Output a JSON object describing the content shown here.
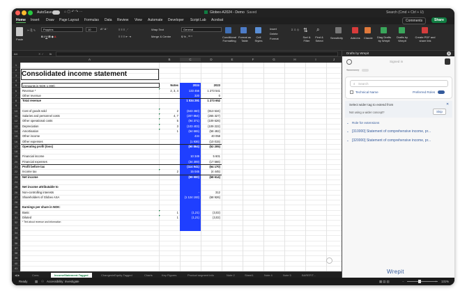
{
  "window": {
    "app_label": "AutoSave",
    "file_title": "Globex-A2024 - Demo",
    "saved": "Saved",
    "search_placeholder": "Search (Cmd + Ctrl + U)"
  },
  "ribbon_tabs": [
    "Home",
    "Insert",
    "Draw",
    "Page Layout",
    "Formulas",
    "Data",
    "Review",
    "View",
    "Automate",
    "Developer",
    "Script Lab",
    "Acrobat"
  ],
  "ribbon": {
    "comments_label": "Comments",
    "share_label": "Share",
    "paste": "Paste",
    "font_name": "Poppins",
    "font_size": "10",
    "wrap_text": "Wrap Text",
    "merge_center": "Merge & Centre",
    "number_format": "General",
    "conditional_formatting": "Conditional Formatting",
    "format_as_table": "Format as Table",
    "cell_styles": "Cell Styles",
    "insert": "Insert",
    "delete": "Delete",
    "format": "Format",
    "sort_filter": "Sort & Filter",
    "find_select": "Find & Select",
    "sensitivity": "Sensitivity",
    "add_ins": "Add-ins",
    "claude": "Claude",
    "diag_drafts": "Diag Drafts by Wrepit",
    "drafts_by_wrepit": "Drafts by Wrepit",
    "create_pdf": "Create PDF and share link"
  },
  "formula_bar": {
    "cell_ref": "A4",
    "fx": "fx"
  },
  "columns": [
    "A",
    "B",
    "C",
    "D",
    "E",
    "F",
    "G",
    "H",
    "I",
    "J"
  ],
  "rows": [
    "1",
    "2",
    "3",
    "4",
    "5",
    "6",
    "7",
    "8",
    "9",
    "10",
    "11",
    "12",
    "13",
    "14",
    "15",
    "16",
    "17",
    "18",
    "19",
    "20",
    "21",
    "22",
    "23",
    "24",
    "25",
    "26",
    "27",
    "28",
    "29",
    "30",
    "31",
    "32",
    "33",
    "34",
    "35",
    "36",
    "37",
    "38",
    "39",
    "40",
    "41"
  ],
  "sheet": {
    "title": "Consolidated income statement",
    "unit_label": "(Amounts in NOK 1 000)",
    "notes_header": "Notes",
    "year1": "2024",
    "year2": "2023",
    "lines": [
      {
        "row": 6,
        "label": "Revenue *",
        "notes": "2, 3, 4",
        "v1": "133 456",
        "v2": "1 273 541"
      },
      {
        "row": 7,
        "label": "Other revenue",
        "notes": "",
        "v1": "320",
        "v2": "0"
      },
      {
        "row": 8,
        "label": "Total revenue",
        "notes": "",
        "v1": "1 034 291",
        "v2": "1 273 652",
        "bold": true
      },
      {
        "row": 10,
        "label": "Cost of goods sold",
        "notes": "2",
        "v1": "(643 460)",
        "v2": "(813 534)"
      },
      {
        "row": 11,
        "label": "Salaries and personnel costs",
        "notes": "4, 7",
        "v1": "(207 864)",
        "v2": "(265 327)"
      },
      {
        "row": 12,
        "label": "Other operational costs",
        "notes": "5",
        "v1": "(94 371)",
        "v2": "(109 626)"
      },
      {
        "row": 13,
        "label": "Depreciation",
        "notes": "3",
        "v1": "(103 403)",
        "v2": "(109 222)"
      },
      {
        "row": 14,
        "label": "Amortisation",
        "notes": "1",
        "v1": "(64 665)",
        "v2": "(58 492)"
      },
      {
        "row": 15,
        "label": "Other income",
        "notes": "",
        "v1": "434",
        "v2": "40 058"
      },
      {
        "row": 16,
        "label": "Other expenses",
        "notes": "",
        "v1": "(1 936)",
        "v2": "(10 015)"
      },
      {
        "row": 17,
        "label": "Operating profit (loss)",
        "notes": "",
        "v1": "(90 864)",
        "v2": "(52 205)",
        "bold": true
      },
      {
        "row": 19,
        "label": "Financial income",
        "notes": "",
        "v1": "10 349",
        "v2": "5 601"
      },
      {
        "row": 20,
        "label": "Financial expenses",
        "notes": "",
        "v1": "(34 309)",
        "v2": "(17 566)"
      },
      {
        "row": 21,
        "label": "Profit before tax",
        "notes": "",
        "v1": "(114 941)",
        "v2": "(64 170)",
        "bold": true
      },
      {
        "row": 22,
        "label": "Income tax",
        "notes": "2",
        "v1": "15 045",
        "v2": "(4 445)"
      },
      {
        "row": 23,
        "label": "Net income",
        "notes": "",
        "v1": "(99 900)",
        "v2": "(68 614)",
        "bold": true
      },
      {
        "row": 25,
        "label": "Net income attributable to",
        "notes": "",
        "v1": "",
        "v2": "",
        "bold": true
      },
      {
        "row": 26,
        "label": "Non-controlling interests",
        "notes": "",
        "v1": "-",
        "v2": "312"
      },
      {
        "row": 27,
        "label": "Shareholders of Globex ASA",
        "notes": "",
        "v1": "(1 124 193)",
        "v2": "(68 926)"
      },
      {
        "row": 29,
        "label": "Earnings per share in NOK:",
        "notes": "",
        "v1": "",
        "v2": "",
        "bold": true
      },
      {
        "row": 30,
        "label": "Basic",
        "notes": "1",
        "v1": "(1,21)",
        "v2": "(3,02)"
      },
      {
        "row": 31,
        "label": "Diluted",
        "notes": "1",
        "v1": "(1,21)",
        "v2": "(3,02)"
      },
      {
        "row": 32,
        "label": "* Text about revenue and information",
        "notes": "",
        "v1": "",
        "v2": "",
        "small": true
      }
    ]
  },
  "sheet_tabs": [
    "Cons.",
    "IncomeStatement-Tagged",
    "ChangesinEquity-Tagged",
    "Charts",
    "Key Figures",
    "Product segment info",
    "Note 2",
    "Sheet1",
    "Note 4",
    "Note 5",
    "BAREFIT..."
  ],
  "status": {
    "ready": "Ready",
    "accessibility": "Accessibility: Investigate",
    "zoom": "131%"
  },
  "pane": {
    "title": "Drafts by Wrepit",
    "signed_in": "Signed in",
    "toggle_label": "Taxonomy",
    "search_placeholder": "Search",
    "technical_name": "Technical Name",
    "preferred_roles": "Preferred Roles",
    "select_tag": "Select wider tag to extend from",
    "not_using": "Not using a wider concept?",
    "skip": "Skip",
    "sections": [
      "Role for extensions",
      "[310000] Statement of comprehensive income, pr...",
      "[320000] Statement of comprehensive income, pr..."
    ],
    "brand": "Wrepit"
  },
  "colors": {
    "accent_green": "#107c41",
    "selection_blue": "#1f3fff",
    "ribbon_bg": "#2a2a2a"
  }
}
